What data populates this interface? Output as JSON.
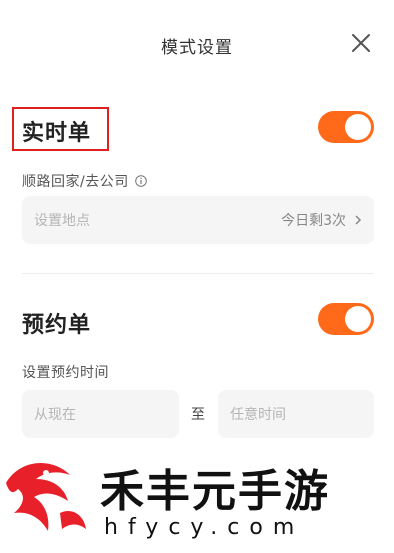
{
  "header": {
    "title": "模式设置",
    "close_icon": "close-icon"
  },
  "realtime": {
    "title": "实时单",
    "toggle_on": true,
    "route_label": "顺路回家/去公司",
    "location_placeholder": "设置地点",
    "remaining": "今日剩3次"
  },
  "reservation": {
    "title": "预约单",
    "toggle_on": true,
    "time_label": "设置预约时间",
    "from_placeholder": "从现在",
    "to_label": "至",
    "to_placeholder": "任意时间"
  },
  "watermark": {
    "name": "禾丰元手游",
    "url": "hfycy.com"
  },
  "colors": {
    "accent": "#ff6a1a",
    "highlight_box": "#e02020",
    "field_bg": "#f5f5f5"
  }
}
